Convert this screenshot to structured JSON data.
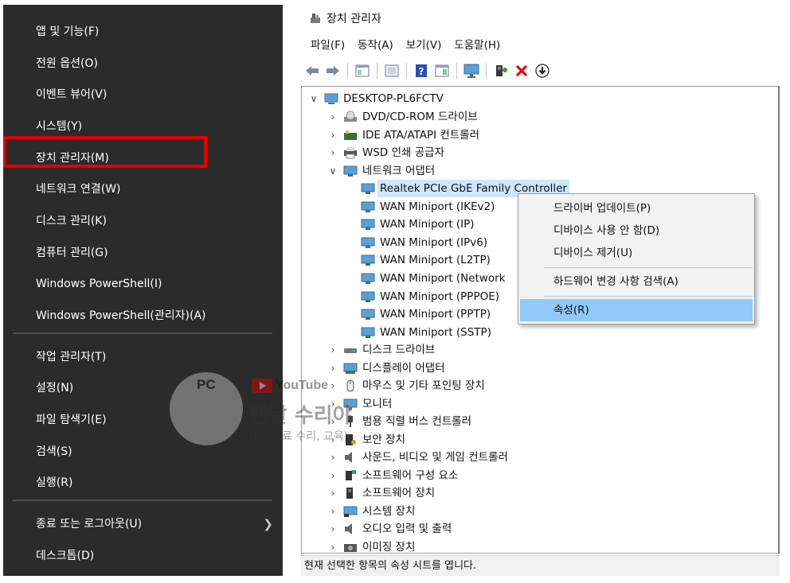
{
  "winx_menu": {
    "items": [
      {
        "label": "앱 및 기능(F)"
      },
      {
        "label": "전원 옵션(O)"
      },
      {
        "label": "이벤트 뷰어(V)"
      },
      {
        "label": "시스템(Y)"
      },
      {
        "label": "장치 관리자(M)",
        "highlighted": true
      },
      {
        "label": "네트워크 연결(W)"
      },
      {
        "label": "디스크 관리(K)"
      },
      {
        "label": "컴퓨터 관리(G)"
      },
      {
        "label": "Windows PowerShell(I)"
      },
      {
        "label": "Windows PowerShell(관리자)(A)"
      },
      {
        "label": "작업 관리자(T)"
      },
      {
        "label": "설정(N)"
      },
      {
        "label": "파일 탐색기(E)"
      },
      {
        "label": "검색(S)"
      },
      {
        "label": "실행(R)"
      },
      {
        "label": "종료 또는 로그아웃(U)",
        "has_submenu": true
      },
      {
        "label": "데스크톱(D)"
      }
    ],
    "highlight_color": "#e20000"
  },
  "device_manager": {
    "title": "장치 관리자",
    "menu": [
      "파일(F)",
      "동작(A)",
      "보기(V)",
      "도움말(H)"
    ],
    "toolbar_icons": [
      "back-arrow-icon",
      "forward-arrow-icon",
      "properties-icon",
      "show-hidden-icon",
      "help-icon",
      "view-icon",
      "monitor-icon",
      "add-driver-icon",
      "uninstall-icon",
      "update-driver-icon"
    ],
    "tree": {
      "root": "DESKTOP-PL6FCTV",
      "categories_top": [
        "DVD/CD-ROM 드라이브",
        "IDE ATA/ATAPI 컨트롤러",
        "WSD 인쇄 공급자"
      ],
      "network_category": "네트워크 어댑터",
      "network_devices": [
        "Realtek PCIe GbE Family Controller",
        "WAN Miniport (IKEv2)",
        "WAN Miniport (IP)",
        "WAN Miniport (IPv6)",
        "WAN Miniport (L2TP)",
        "WAN Miniport (Network",
        "WAN Miniport (PPPOE)",
        "WAN Miniport (PPTP)",
        "WAN Miniport (SSTP)"
      ],
      "categories_bottom": [
        "디스크 드라이브",
        "디스플레이 어댑터",
        "마우스 및 기타 포인팅 장치",
        "모니터",
        "범용 직렬 버스 컨트롤러",
        "보안 장치",
        "사운드, 비디오 및 게임 컨트롤러",
        "소프트웨어 구성 요소",
        "소프트웨어 장치",
        "시스템 장치",
        "오디오 입력 및 출력",
        "이미징 장치"
      ]
    },
    "context_menu": {
      "items": [
        "드라이버 업데이트(P)",
        "디바이스 사용 안 함(D)",
        "디바이스 제거(U)",
        "하드웨어 변경 사항 검색(A)",
        "속성(R)"
      ],
      "highlighted": "속성(R)"
    },
    "status_text": "현재 선택한 항목의 속성 시트를 엽니다."
  },
  "watermark": {
    "badge": "PC",
    "platform": "YouTube",
    "main": "맨날 수리야",
    "sub": "(PC 무료 수리, 교육)"
  }
}
